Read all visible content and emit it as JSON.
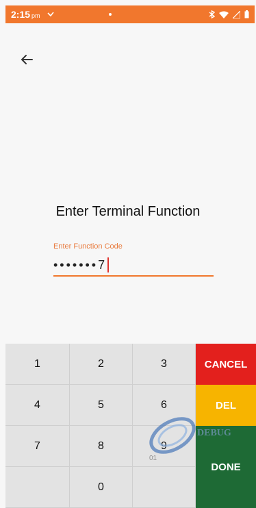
{
  "status_bar": {
    "time": "2:15",
    "meridiem": "pm"
  },
  "page": {
    "title": "Enter Terminal Function",
    "field_label": "Enter Function Code",
    "field_value": "•••••••7"
  },
  "keypad": {
    "keys": [
      "1",
      "2",
      "3",
      "4",
      "5",
      "6",
      "7",
      "8",
      "9",
      "0"
    ],
    "cancel_label": "CANCEL",
    "del_label": "DEL",
    "done_label": "DONE"
  },
  "watermark": {
    "brand": "DEBUG",
    "sub_text": "01"
  },
  "colors": {
    "status_bar": "#f1772d",
    "accent": "#f1772d",
    "cancel": "#e3201d",
    "del": "#f7b400",
    "done": "#1e6a35"
  }
}
